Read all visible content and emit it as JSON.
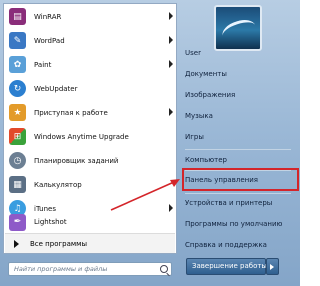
{
  "programs": [
    {
      "label": "WinRAR",
      "icon": "winrar-icon",
      "color": "#8a2d7a",
      "has_submenu": true
    },
    {
      "label": "WordPad",
      "icon": "wordpad-icon",
      "color": "#3a78c4",
      "has_submenu": true
    },
    {
      "label": "Paint",
      "icon": "paint-icon",
      "color": "#5aa0d8",
      "has_submenu": true
    },
    {
      "label": "WebUpdater",
      "icon": "webupdater-icon",
      "color": "#2b7fd0",
      "has_submenu": false
    },
    {
      "label": "Приступая к работе",
      "icon": "getting-started-icon",
      "color": "#e39b2a",
      "has_submenu": true
    },
    {
      "label": "Windows Anytime Upgrade",
      "icon": "windows-flag-icon",
      "color": "#3d8b3d",
      "has_submenu": false
    },
    {
      "label": "Планировщик заданий",
      "icon": "task-scheduler-icon",
      "color": "#6c7f93",
      "has_submenu": false
    },
    {
      "label": "Калькулятор",
      "icon": "calculator-icon",
      "color": "#5b6f85",
      "has_submenu": false
    },
    {
      "label": "iTunes",
      "icon": "itunes-icon",
      "color": "#3a9de0",
      "has_submenu": true
    },
    {
      "label": "Lightshot",
      "icon": "lightshot-icon",
      "color": "#8e5ac8",
      "has_submenu": false
    }
  ],
  "all_programs_label": "Все программы",
  "search_placeholder": "Найти программы и файлы",
  "right_items": [
    "User",
    "Документы",
    "Изображения",
    "Музыка",
    "Игры",
    "Компьютер",
    "Панель управления",
    "Устройства и принтеры",
    "Программы по умолчанию",
    "Справка и поддержка"
  ],
  "shutdown_label": "Завершение работы",
  "colors": {
    "highlight_box": "#d4252a",
    "annotation_arrow": "#d4252a"
  }
}
